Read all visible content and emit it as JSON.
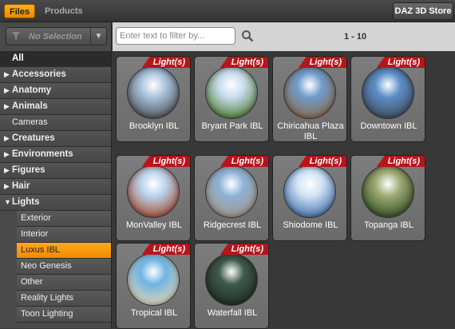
{
  "tabs": {
    "files": "Files",
    "products": "Products"
  },
  "store_button": "DAZ 3D Store",
  "selection": {
    "text": "No Selection"
  },
  "categories": [
    {
      "label": "All",
      "kind": "all"
    },
    {
      "label": "Accessories",
      "kind": "collapsed"
    },
    {
      "label": "Anatomy",
      "kind": "collapsed"
    },
    {
      "label": "Animals",
      "kind": "collapsed"
    },
    {
      "label": "Cameras",
      "kind": "plain"
    },
    {
      "label": "Creatures",
      "kind": "collapsed"
    },
    {
      "label": "Environments",
      "kind": "collapsed"
    },
    {
      "label": "Figures",
      "kind": "collapsed"
    },
    {
      "label": "Hair",
      "kind": "collapsed"
    },
    {
      "label": "Lights",
      "kind": "expanded"
    }
  ],
  "subcategories": [
    {
      "label": "Exterior",
      "active": false
    },
    {
      "label": "Interior",
      "active": false
    },
    {
      "label": "Luxus IBL",
      "active": true
    },
    {
      "label": "Neo Genesis",
      "active": false
    },
    {
      "label": "Other",
      "active": false
    },
    {
      "label": "Reality Lights",
      "active": false
    },
    {
      "label": "Toon Lighting",
      "active": false
    }
  ],
  "search": {
    "placeholder": "Enter text to filter by..."
  },
  "pager": "1 - 10",
  "badge_label": "Light(s)",
  "items": [
    {
      "label": "Brooklyn IBL",
      "sky": "#a9c4dc",
      "ground": "#4a4e54"
    },
    {
      "label": "Bryant Park IBL",
      "sky": "#c8dcef",
      "ground": "#4f7a2e"
    },
    {
      "label": "Chiricahua Plaza IBL",
      "sky": "#6f9ccd",
      "ground": "#8b6a48"
    },
    {
      "label": "Downtown IBL",
      "sky": "#5d8fc8",
      "ground": "#3d4a5a"
    },
    {
      "label": "MonValley IBL",
      "sky": "#b9d3ec",
      "ground": "#a4482a"
    },
    {
      "label": "Ridgecrest IBL",
      "sky": "#8eb2d8",
      "ground": "#a09580"
    },
    {
      "label": "Shiodome IBL",
      "sky": "#cfe3f4",
      "ground": "#3e6bab"
    },
    {
      "label": "Topanga IBL",
      "sky": "#9eaa74",
      "ground": "#2e4a1e"
    },
    {
      "label": "Tropical IBL",
      "sky": "#6fb4e4",
      "ground": "#e7d7b2"
    },
    {
      "label": "Waterfall IBL",
      "sky": "#3f5a4a",
      "ground": "#1e2a24"
    }
  ]
}
